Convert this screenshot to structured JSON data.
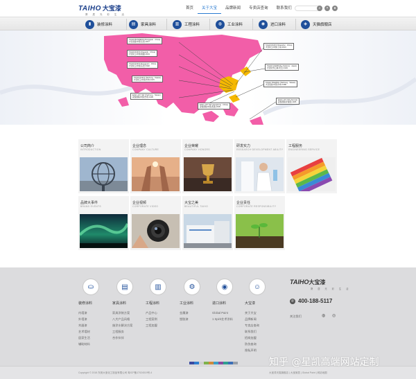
{
  "header": {
    "logo_brand": "TAIHO",
    "logo_cn": "大宝漆",
    "logo_tagline": "葵 居 光 彩 生 活",
    "nav": [
      {
        "label": "首页",
        "active": false
      },
      {
        "label": "关于大宝",
        "active": true
      },
      {
        "label": "品牌新闻",
        "active": false
      },
      {
        "label": "专卖店查询",
        "active": false
      },
      {
        "label": "联系我们",
        "active": false
      }
    ],
    "icons": [
      "search-icon",
      "close-icon",
      "user-icon"
    ]
  },
  "categories": [
    {
      "label": "装修涂料",
      "icon": "paint-roller-icon"
    },
    {
      "label": "家具涂料",
      "icon": "cabinet-icon"
    },
    {
      "label": "工程涂料",
      "icon": "building-icon"
    },
    {
      "label": "工业涂料",
      "icon": "car-icon"
    },
    {
      "label": "进口涂料",
      "icon": "globe-icon"
    },
    {
      "label": "天猫旗舰店",
      "icon": "shopping-bag-icon"
    }
  ],
  "banner": {
    "callouts": [
      {
        "line1": "TAIHO BUSINESS (Dongguan · China)",
        "line2": "大宝商贸(中国·东莞) 2017"
      },
      {
        "line1": "TAIHO PAINT (Chengdu · China)",
        "line2": "大宝化工(中国·成都) 2019"
      },
      {
        "line1": "TAIHO PAINT (Dongguan · China)",
        "line2": "大宝化工(中国·东莞) 1992"
      },
      {
        "line1": "TAIHO PAINT (Taichung · Taiwan)",
        "line2": "大宝化工(中国·台中) 1970"
      },
      {
        "line1": "EASY JOY INT (Taichung · Taiwan)",
        "line2": "喜悦国际(中国·台中) 1999"
      },
      {
        "line1": "EASY JOY INT (Hongkong · China)",
        "line2": "喜悦国际(中国·香港) 2005"
      },
      {
        "line1": "TAIHO PAINT (Shanghai · China)",
        "line2": "大宝化工(中国·上海) 2015"
      },
      {
        "line1": "TAIHO CHEMICAL (Saitama · Japan)",
        "line2": "大宝化学(日本·埼玉) 1949"
      },
      {
        "line1": "TAIHO TRADING (Taichung · Taiwan)",
        "line2": "大宝贸易(中国·台中) 1988"
      },
      {
        "line1": "EASY JOY INT (Samoa)",
        "line2": "喜悦国际(萨摩亚) 2005"
      }
    ]
  },
  "tiles": [
    {
      "title": "公司简介",
      "sub": "INTRODUCTION",
      "img": "globe-sculpture"
    },
    {
      "title": "企业理念",
      "sub": "COMPANY CULTURE",
      "img": "raised-hands"
    },
    {
      "title": "企业荣耀",
      "sub": "COMPANY HONORS",
      "img": "trophy"
    },
    {
      "title": "研发实力",
      "sub": "RESEARCH·DEVELOPMENT ABILITY",
      "img": "lab"
    },
    {
      "title": "工程服务",
      "sub": "ENGINEERING SERVICE",
      "img": "color-swatches"
    },
    {
      "title": "品牌大事件",
      "sub": "BRAND EVENTS",
      "img": "aurora"
    },
    {
      "title": "企业视频",
      "sub": "CORPORATE VIDEO",
      "img": "camera-lens"
    },
    {
      "title": "大宝之美",
      "sub": "BEAUTIFUL TAIHO",
      "img": "factory"
    },
    {
      "title": "企业责任",
      "sub": "CORPORATE RESPONSIBILITY",
      "img": "seedling"
    }
  ],
  "footer": {
    "columns": [
      {
        "head": "装修涂料",
        "icon": "paint-bucket-icon",
        "items": [
          "内墙漆",
          "外墙漆",
          "木器漆",
          "艺术墙材",
          "居家生活",
          "辅助材料"
        ]
      },
      {
        "head": "家具涂料",
        "icon": "cabinet-icon",
        "items": [
          "家具涂装方案",
          "八大产品风格",
          "施涂水解决方案",
          "工程服务",
          "合作伙伴"
        ]
      },
      {
        "head": "工程涂料",
        "icon": "building-icon",
        "items": [
          "产品中心",
          "工程案例",
          "工程加盟"
        ]
      },
      {
        "head": "工业涂料",
        "icon": "motorcycle-icon",
        "items": [
          "金属漆",
          "塑胶漆"
        ]
      },
      {
        "head": "进口涂料",
        "icon": "globe-icon",
        "items": [
          "Global Paint",
          "1 Spirit艺术涂料"
        ]
      },
      {
        "head": "大宝漆",
        "icon": "person-icon",
        "items": [
          "关于大宝",
          "品牌新闻",
          "专卖店查询",
          "联系我们",
          "招商加盟",
          "防伪查询",
          "隐私声明"
        ]
      }
    ],
    "logo_brand": "TAIHO",
    "logo_cn": "大宝漆",
    "logo_tagline": "葵 居 光 彩 生 活",
    "phone": "400-188-5117",
    "follow_label": "关注我们",
    "copyright": "Copyright © 2018 东莞大宝化工制品有限公司  粤ICP备17024019号-4",
    "bottom_links": "大宝漆天猫旗舰店  |  大宝家居  |  Global Paint  |  网站地图",
    "colorbar": [
      "#3a4aa0",
      "#2f7fd0",
      "#d0d0d0",
      "#7fb24a",
      "#d08a3a",
      "#3ba0c8",
      "#8a4aa0",
      "#2fa090",
      "#3a6fb8",
      "#9aa0a8"
    ]
  },
  "watermark": "知乎 @星凯高端网站定制"
}
